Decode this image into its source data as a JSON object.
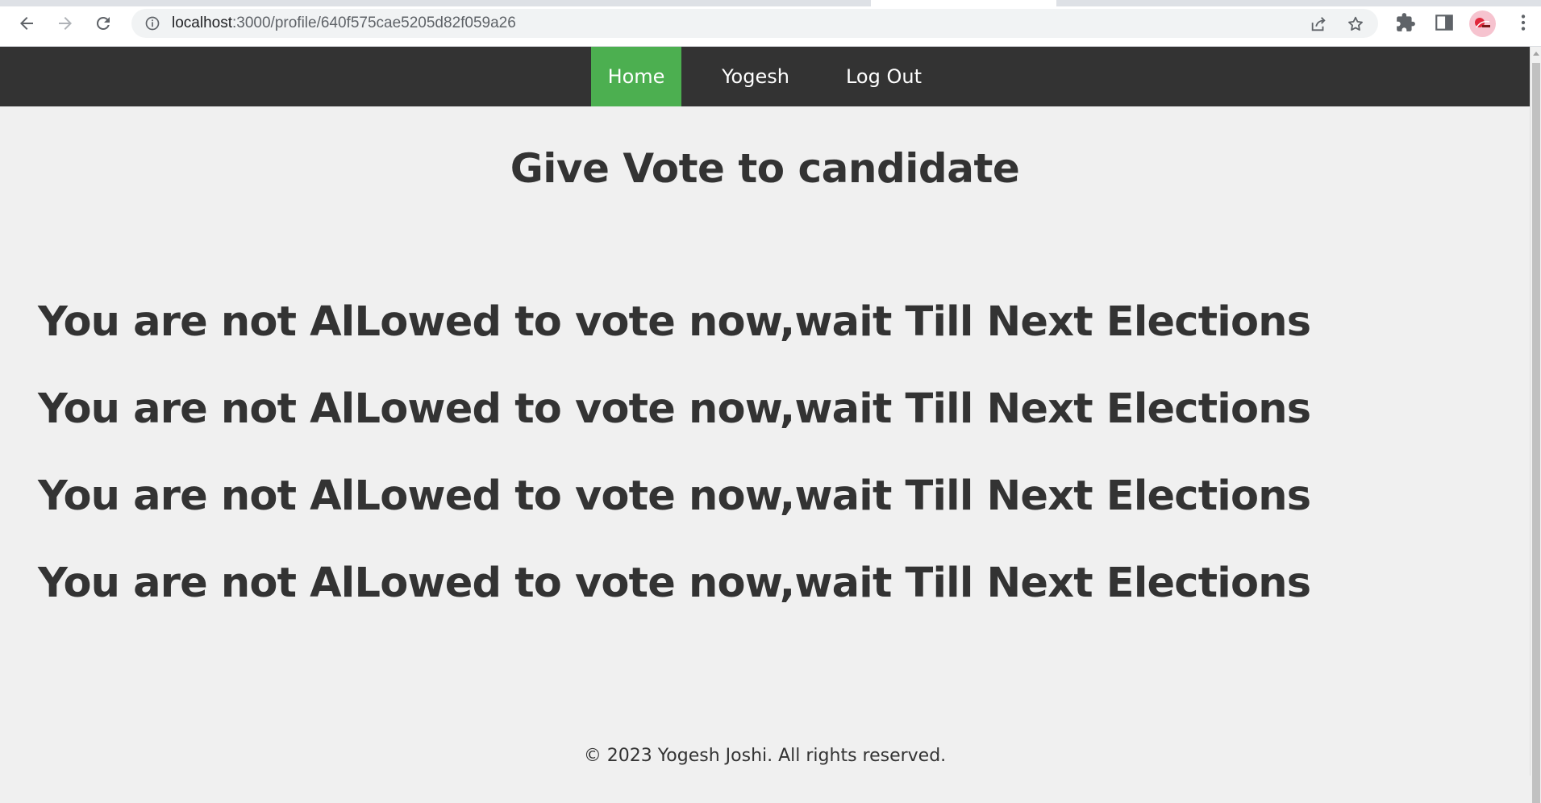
{
  "browser": {
    "url_host": "localhost",
    "url_path": ":3000/profile/640f575cae5205d82f059a26",
    "icons": {
      "back": "arrow-left-icon",
      "forward": "arrow-right-icon",
      "reload": "reload-icon",
      "site_info": "info-icon",
      "share": "share-icon",
      "bookmark": "star-icon",
      "extensions": "puzzle-icon",
      "side_panel": "side-panel-icon",
      "menu": "kebab-menu-icon"
    }
  },
  "navbar": {
    "items": [
      {
        "label": "Home",
        "active": true
      },
      {
        "label": "Yogesh",
        "active": false
      },
      {
        "label": "Log Out",
        "active": false
      }
    ],
    "colors": {
      "background": "#333333",
      "active": "#4caf50",
      "text": "#ffffff"
    }
  },
  "main": {
    "title": "Give Vote to candidate",
    "notices": [
      "You are not AlLowed to vote now,wait Till Next Elections",
      "You are not AlLowed to vote now,wait Till Next Elections",
      "You are not AlLowed to vote now,wait Till Next Elections",
      "You are not AlLowed to vote now,wait Till Next Elections"
    ]
  },
  "footer": {
    "text": "© 2023 Yogesh Joshi. All rights reserved."
  }
}
